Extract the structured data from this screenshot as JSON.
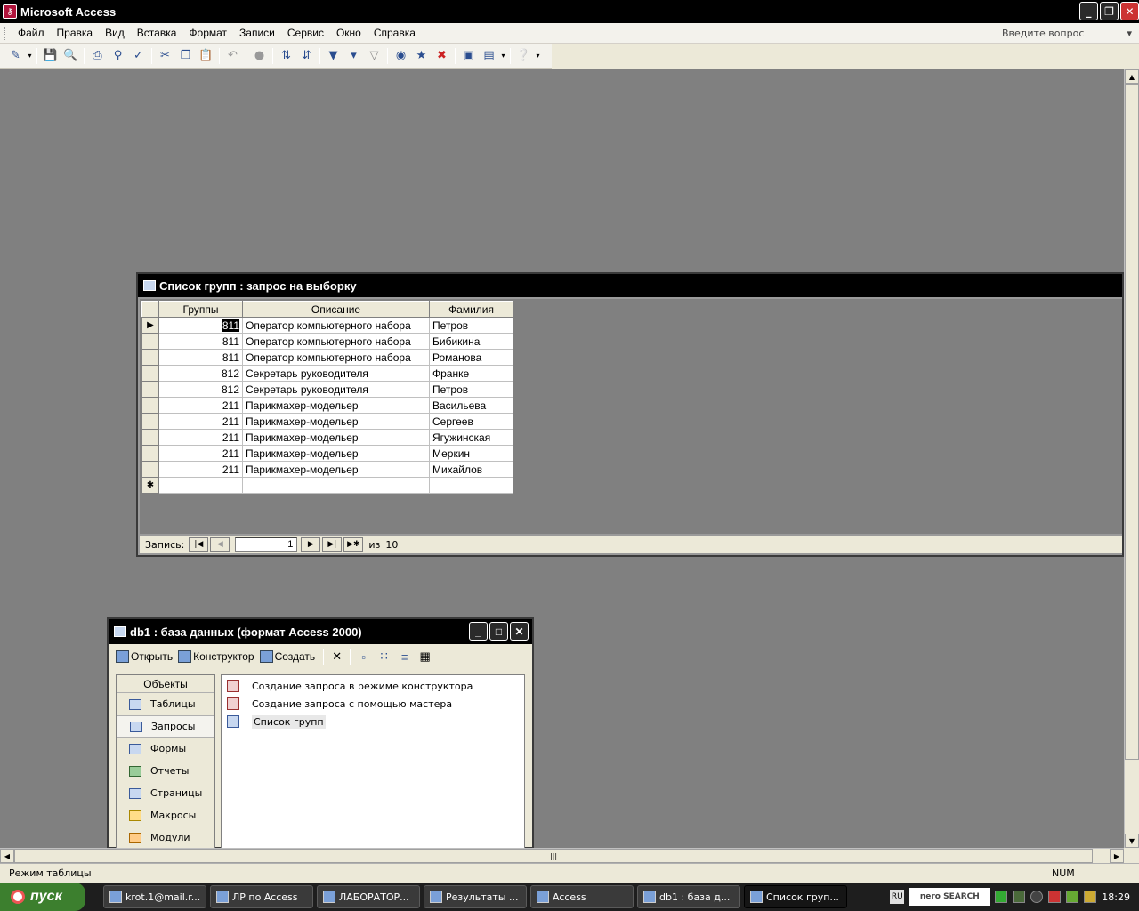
{
  "app": {
    "title": "Microsoft Access"
  },
  "menu": {
    "items": [
      {
        "label": "Файл"
      },
      {
        "label": "Правка"
      },
      {
        "label": "Вид"
      },
      {
        "label": "Вставка"
      },
      {
        "label": "Формат"
      },
      {
        "label": "Записи"
      },
      {
        "label": "Сервис"
      },
      {
        "label": "Окно"
      },
      {
        "label": "Справка"
      }
    ],
    "ask_placeholder": "Введите вопрос"
  },
  "query_window": {
    "title": "Список групп : запрос на выборку",
    "columns": [
      "Группы",
      "Описание",
      "Фамилия"
    ],
    "rows": [
      [
        "811",
        "Оператор компьютерного набора",
        "Петров"
      ],
      [
        "811",
        "Оператор компьютерного набора",
        "Бибикина"
      ],
      [
        "811",
        "Оператор компьютерного набора",
        "Романова"
      ],
      [
        "812",
        "Секретарь руководителя",
        "Франке"
      ],
      [
        "812",
        "Секретарь руководителя",
        "Петров"
      ],
      [
        "211",
        "Парикмахер-модельер",
        "Васильева"
      ],
      [
        "211",
        "Парикмахер-модельер",
        "Сергеев"
      ],
      [
        "211",
        "Парикмахер-модельер",
        "Ягужинская"
      ],
      [
        "211",
        "Парикмахер-модельер",
        "Меркин"
      ],
      [
        "211",
        "Парикмахер-модельер",
        "Михайлов"
      ]
    ],
    "nav": {
      "label": "Запись:",
      "current": "1",
      "of_label": "из",
      "total": "10"
    }
  },
  "db_window": {
    "title": "db1 : база данных (формат Access 2000)",
    "toolbar": {
      "open": "Открыть",
      "design": "Конструктор",
      "create": "Создать"
    },
    "objects_header": "Объекты",
    "objects": [
      "Таблицы",
      "Запросы",
      "Формы",
      "Отчеты",
      "Страницы",
      "Макросы",
      "Модули"
    ],
    "active_object": "Запросы",
    "list": [
      "Создание запроса в режиме конструктора",
      "Создание запроса с помощью мастера",
      "Список групп"
    ]
  },
  "status": {
    "text": "Режим таблицы",
    "num": "NUM"
  },
  "taskbar": {
    "start": "пуск",
    "tasks": [
      "krot.1@mail.r...",
      "ЛР по Access",
      "ЛАБОРАТОР...",
      "Результаты ...",
      "Access",
      "db1 : база д...",
      "Список груп..."
    ],
    "lang": "RU",
    "nero": "nero SEARCH",
    "clock": "18:29"
  }
}
